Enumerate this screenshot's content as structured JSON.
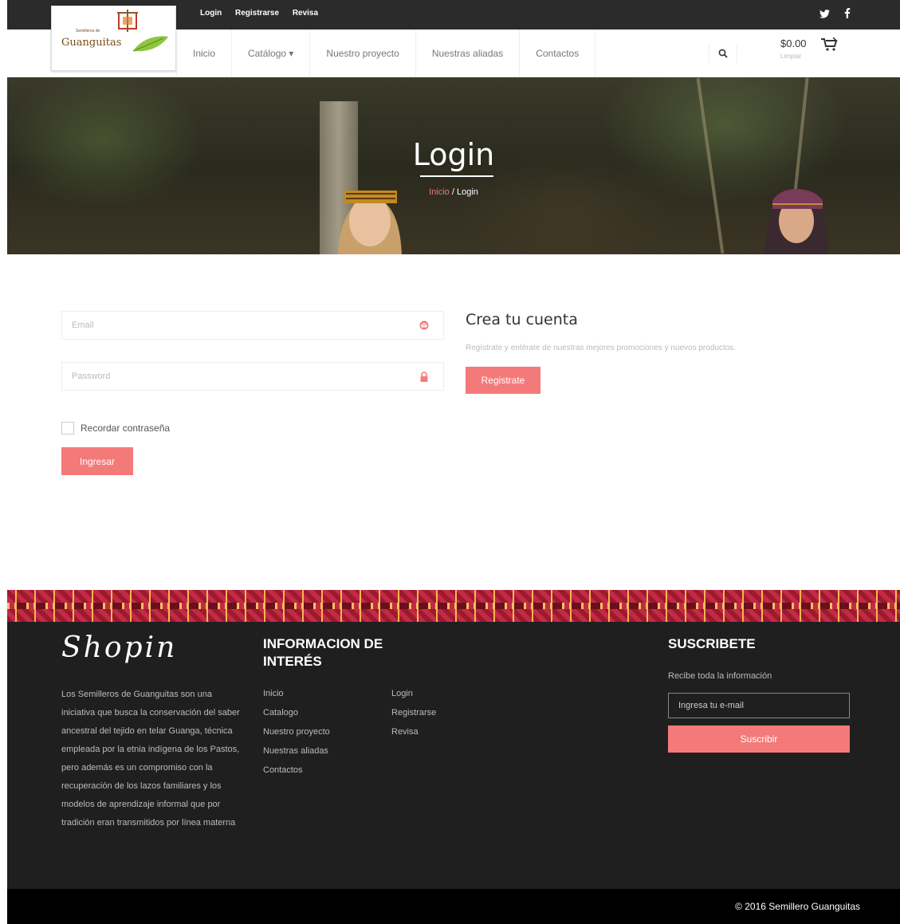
{
  "topbar": {
    "links": [
      "Login",
      "Registrarse",
      "Revisa"
    ],
    "social": [
      "twitter-icon",
      "facebook-icon"
    ]
  },
  "logo": {
    "name": "Guanguitas",
    "sub": "Semilleros de"
  },
  "nav": {
    "items": [
      "Inicio",
      "Catálogo ▾",
      "Nuestro proyecto",
      "Nuestras aliadas",
      "Contactos"
    ]
  },
  "cart": {
    "total": "$0.00",
    "clear": "Limpiar"
  },
  "hero": {
    "title": "Login",
    "crumb_home": "Inicio",
    "crumb_sep": " / ",
    "crumb_current": "Login"
  },
  "login": {
    "email_placeholder": "Email",
    "password_placeholder": "Password",
    "remember_label": "Recordar contraseña",
    "submit_label": "Ingresar"
  },
  "register": {
    "title": "Crea tu cuenta",
    "text": "Regístrate y entérate de nuestras mejores promociones y nuevos productos.",
    "button_label": "Registrate"
  },
  "footer": {
    "brand": "Shopin",
    "about": "Los Semilleros de Guanguitas son una iniciativa que busca la conservación del saber ancestral del tejido en telar Guanga, técnica empleada por la etnia indígena de los Pastos, pero además es un compromiso con la recuperación de los lazos familiares y los modelos de aprendizaje informal que por tradición eran transmitidos por línea materna",
    "info_title": "INFORMACION DE INTERÉS",
    "info_col1": [
      "Inicio",
      "Catalogo",
      "Nuestro proyecto",
      "Nuestras aliadas",
      "Contactos"
    ],
    "info_col2": [
      "Login",
      "Registrarse",
      "Revisa"
    ],
    "subscribe_title": "SUSCRIBETE",
    "subscribe_text": "Recibe toda la información",
    "subscribe_placeholder": "Ingresa tu e-mail",
    "subscribe_button": "Suscribir",
    "copyright": "© 2016 Semillero Guanguitas"
  },
  "colors": {
    "accent": "#f47a7a",
    "dark": "#1f1f1f",
    "topbar": "#2b2b2b"
  }
}
